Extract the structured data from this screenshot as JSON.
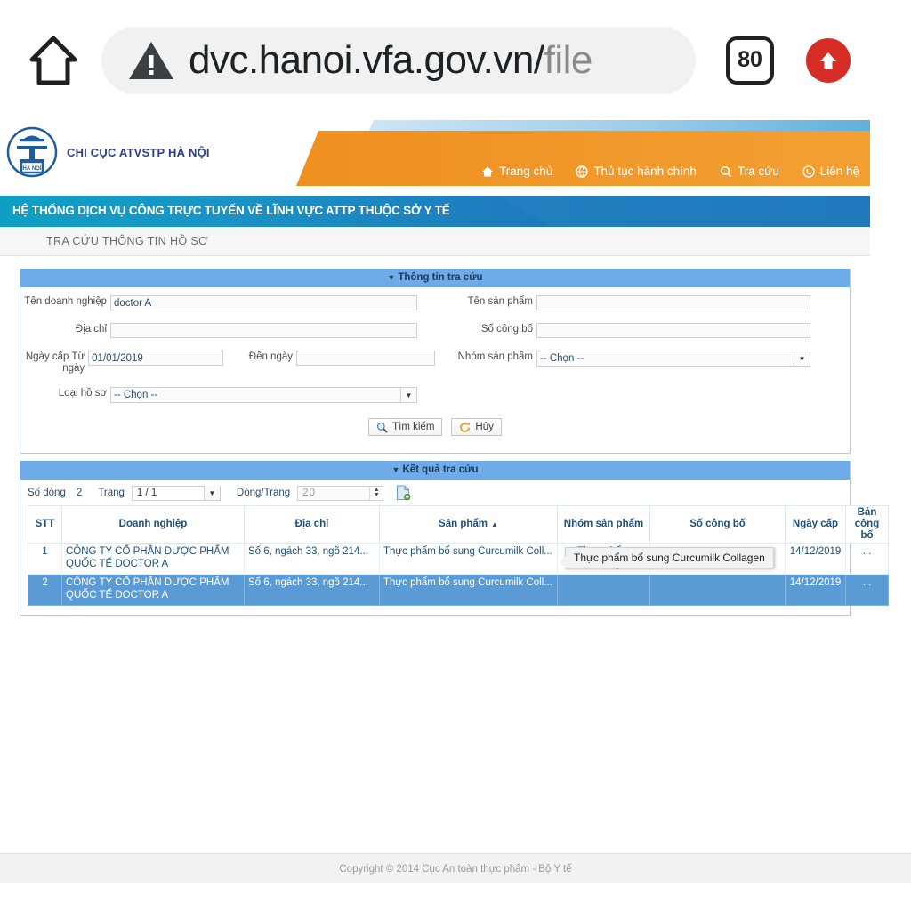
{
  "browser": {
    "home_icon": "home-icon",
    "warning_icon": "warning-triangle-icon",
    "url_visible": "dvc.hanoi.vfa.gov.vn/",
    "url_dim": "file",
    "tab_count": "80",
    "upload_icon": "upload-arrow-icon",
    "accent_red": "#d62e26"
  },
  "site": {
    "logo_label": "CHI CỤC ATVSTP HÀ NỘI",
    "nav": [
      {
        "label": "Trang chủ",
        "icon": "home-icon"
      },
      {
        "label": "Thủ tục hành chính",
        "icon": "globe-icon"
      },
      {
        "label": "Tra cứu",
        "icon": "search-icon"
      },
      {
        "label": "Liên hệ",
        "icon": "phone-icon"
      }
    ],
    "banner": "HỆ THỐNG DỊCH VỤ CÔNG TRỰC TUYẾN VỀ LĨNH VỰC ATTP THUỘC SỞ Y TẾ",
    "breadcrumb": "TRA CỨU THÔNG TIN HỒ SƠ",
    "orange": "#f0901e",
    "blue": "#1a7fc1",
    "panel_blue": "#6fabe8"
  },
  "search_panel": {
    "title": "Thông tin tra cứu",
    "fields": {
      "ten_doanh_nghiep_label": "Tên doanh nghiệp",
      "ten_doanh_nghiep_value": "doctor A",
      "dia_chi_label": "Địa chỉ",
      "dia_chi_value": "",
      "ngay_cap_label": "Ngày cấp Từ ngày",
      "ngay_cap_value": "01/01/2019",
      "den_ngay_label": "Đến ngày",
      "den_ngay_value": "",
      "loai_ho_so_label": "Loại hồ sơ",
      "loai_ho_so_value": "-- Chọn --",
      "ten_san_pham_label": "Tên sản phẩm",
      "ten_san_pham_value": "",
      "so_cong_bo_label": "Số công bố",
      "so_cong_bo_value": "",
      "nhom_san_pham_label": "Nhóm sản phẩm",
      "nhom_san_pham_value": "-- Chọn --"
    },
    "buttons": {
      "search": "Tìm kiếm",
      "cancel": "Hủy"
    }
  },
  "results_panel": {
    "title": "Kết quả tra cứu",
    "paging": {
      "rows_label": "Số dòng",
      "rows_count": "2",
      "page_label": "Trang",
      "page_value": "1 / 1",
      "per_page_label": "Dòng/Trang",
      "per_page_value": "20",
      "export_icon": "export-excel-icon"
    },
    "columns": [
      "STT",
      "Doanh nghiệp",
      "Địa chỉ",
      "Sản phẩm",
      "Nhóm sản phẩm",
      "Số công bố",
      "Ngày cấp",
      "Bản công bố"
    ],
    "sorted_column_index": 3,
    "sort_direction": "asc",
    "rows": [
      {
        "stt": "1",
        "doanh_nghiep": "CÔNG TY CỔ PHẦN DƯỢC PHẨM QUỐC TẾ DOCTOR A",
        "dia_chi": "Số 6, ngách 33, ngõ 214...",
        "san_pham": "Thực phẩm bổ sung Curcumilk Coll...",
        "nhom_san_pham": "Thực phẩm thường",
        "so_cong_bo": "",
        "ngay_cap": "14/12/2019",
        "ban_cong_bo": "...",
        "selected": false
      },
      {
        "stt": "2",
        "doanh_nghiep": "CÔNG TY CỔ PHẦN DƯỢC PHẨM QUỐC TẾ DOCTOR A",
        "dia_chi": "Số 6, ngách 33, ngõ 214...",
        "san_pham": "Thực phẩm bổ sung Curcumilk Coll...",
        "nhom_san_pham": "",
        "so_cong_bo": "",
        "ngay_cap": "14/12/2019",
        "ban_cong_bo": "...",
        "selected": true
      }
    ],
    "tooltip": "Thực phẩm bổ sung Curcumilk Collagen"
  },
  "footer": {
    "copyright": "Copyright © 2014 Cục An toàn thực phẩm - Bộ Y tế"
  }
}
